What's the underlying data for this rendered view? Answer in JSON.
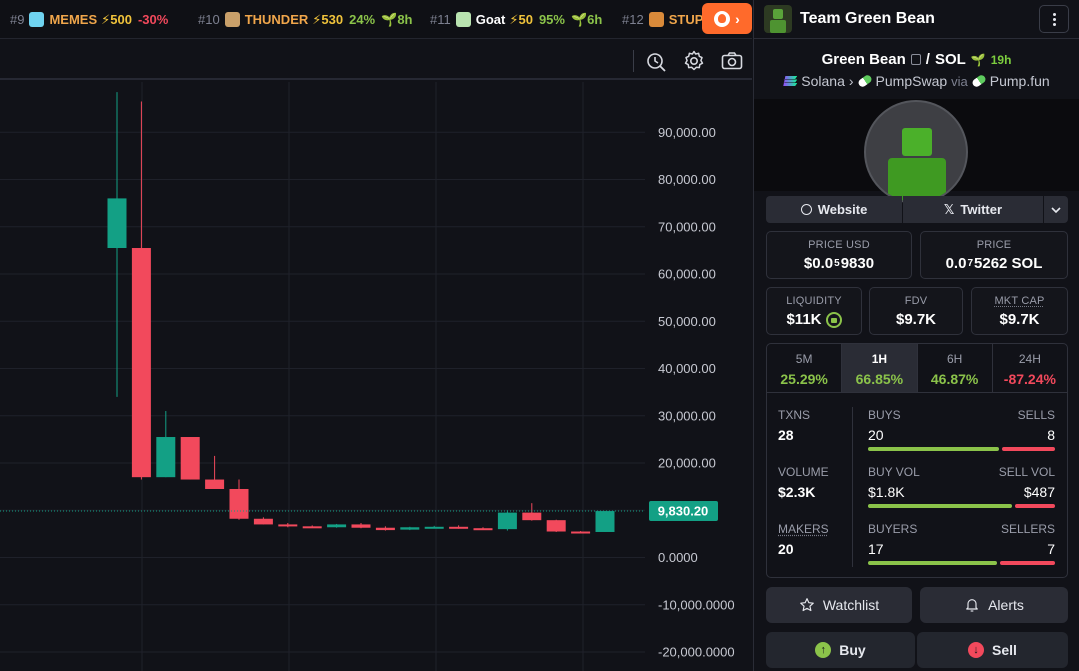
{
  "ticker": [
    {
      "rank": "#9",
      "name": "MEMES",
      "boost": "⚡500",
      "change": "-30%",
      "age": "",
      "logo_color": "#6fd3f0",
      "name_white": false
    },
    {
      "rank": "#10",
      "name": "THUNDER",
      "boost": "⚡530",
      "change": "24%",
      "age": "8h",
      "logo_color": "#c9a06a",
      "name_white": false
    },
    {
      "rank": "#11",
      "name": "Goat",
      "boost": "⚡50",
      "change": "95%",
      "age": "6h",
      "logo_color": "#b9e3b0",
      "name_white": true
    },
    {
      "rank": "#12",
      "name": "STUP",
      "boost": "",
      "change": "",
      "age": "",
      "logo_color": "#d98a3a",
      "name_white": false
    }
  ],
  "hot_button": {
    "icon": "flame-icon",
    "arrow": "›"
  },
  "toolbar": {
    "icons": [
      "indicator-icon",
      "gear-icon",
      "camera-icon"
    ]
  },
  "panel": {
    "team_name": "Team Green Bean",
    "token_name": "Green Bean",
    "separator": "/",
    "quote": "SOL",
    "pair_age": "19h",
    "chain": "Solana",
    "dex": "PumpSwap",
    "via": "via",
    "launchpad": "Pump.fun",
    "links": {
      "website": "Website",
      "twitter": "Twitter"
    },
    "price_usd": {
      "label": "PRICE USD",
      "prefix": "$0.0",
      "sub": "5",
      "rest": "9830"
    },
    "price_sol": {
      "label": "PRICE",
      "prefix": "0.0",
      "sub": "7",
      "rest": "5262 SOL"
    },
    "liquidity": {
      "label": "LIQUIDITY",
      "value": "$11K"
    },
    "fdv": {
      "label": "FDV",
      "value": "$9.7K"
    },
    "mkt_cap": {
      "label": "MKT CAP",
      "value": "$9.7K"
    },
    "timeframes": [
      {
        "label": "5M",
        "value": "25.29%",
        "positive": true,
        "active": false
      },
      {
        "label": "1H",
        "value": "66.85%",
        "positive": true,
        "active": true
      },
      {
        "label": "6H",
        "value": "46.87%",
        "positive": true,
        "active": false
      },
      {
        "label": "24H",
        "value": "-87.24%",
        "positive": false,
        "active": false
      }
    ],
    "txns": {
      "label": "TXNS",
      "value": "28",
      "buys_label": "BUYS",
      "buys": "20",
      "sells_label": "SELLS",
      "sells": "8",
      "buy_fraction": 0.714
    },
    "volume": {
      "label": "VOLUME",
      "value": "$2.3K",
      "buy_label": "BUY VOL",
      "buy": "$1.8K",
      "sell_label": "SELL VOL",
      "sell": "$487",
      "buy_fraction": 0.787
    },
    "makers": {
      "label": "MAKERS",
      "value": "20",
      "buyers_label": "BUYERS",
      "buyers": "17",
      "sellers_label": "SELLERS",
      "sellers": "7",
      "buy_fraction": 0.708
    },
    "watchlist": "Watchlist",
    "alerts": "Alerts",
    "buy": "Buy",
    "sell": "Sell",
    "colors": {
      "up": "#13a085",
      "down": "#f2495c",
      "accent_green": "#8bc34a"
    }
  },
  "chart_data": {
    "type": "candlestick",
    "y_ticks": [
      "90,000.00",
      "80,000.00",
      "70,000.00",
      "60,000.00",
      "50,000.00",
      "40,000.00",
      "30,000.00",
      "20,000.00",
      "10,000.00",
      "0.0000",
      "-10,000.0000",
      "-20,000.0000"
    ],
    "ylim": [
      -21000,
      98500
    ],
    "last_price_label": "9,830.20",
    "last_price": 9830.2,
    "candles": [
      {
        "o": 65500,
        "h": 98500,
        "l": 34000,
        "c": 76000
      },
      {
        "o": 65500,
        "h": 96500,
        "l": 16500,
        "c": 17000
      },
      {
        "o": 17000,
        "h": 31000,
        "l": 17000,
        "c": 25500
      },
      {
        "o": 25500,
        "h": 25500,
        "l": 16500,
        "c": 16500
      },
      {
        "o": 16500,
        "h": 21500,
        "l": 14500,
        "c": 14500
      },
      {
        "o": 14500,
        "h": 16500,
        "l": 8000,
        "c": 8200
      },
      {
        "o": 8200,
        "h": 8500,
        "l": 7000,
        "c": 7000
      },
      {
        "o": 7000,
        "h": 7300,
        "l": 6400,
        "c": 6600
      },
      {
        "o": 6600,
        "h": 6800,
        "l": 6300,
        "c": 6400
      },
      {
        "o": 6400,
        "h": 7100,
        "l": 6300,
        "c": 7000
      },
      {
        "o": 7000,
        "h": 7300,
        "l": 6200,
        "c": 6300
      },
      {
        "o": 6300,
        "h": 6600,
        "l": 5700,
        "c": 5800
      },
      {
        "o": 5900,
        "h": 6500,
        "l": 5800,
        "c": 6400
      },
      {
        "o": 6400,
        "h": 6700,
        "l": 6200,
        "c": 6500
      },
      {
        "o": 6500,
        "h": 6800,
        "l": 6100,
        "c": 6200
      },
      {
        "o": 6200,
        "h": 6400,
        "l": 5900,
        "c": 6000
      },
      {
        "o": 6000,
        "h": 10000,
        "l": 5700,
        "c": 9500
      },
      {
        "o": 9500,
        "h": 11500,
        "l": 7800,
        "c": 7900
      },
      {
        "o": 7900,
        "h": 8000,
        "l": 5400,
        "c": 5500
      },
      {
        "o": 5500,
        "h": 5600,
        "l": 5300,
        "c": 5400
      },
      {
        "o": 5400,
        "h": 9830,
        "l": 5400,
        "c": 9830
      }
    ]
  }
}
